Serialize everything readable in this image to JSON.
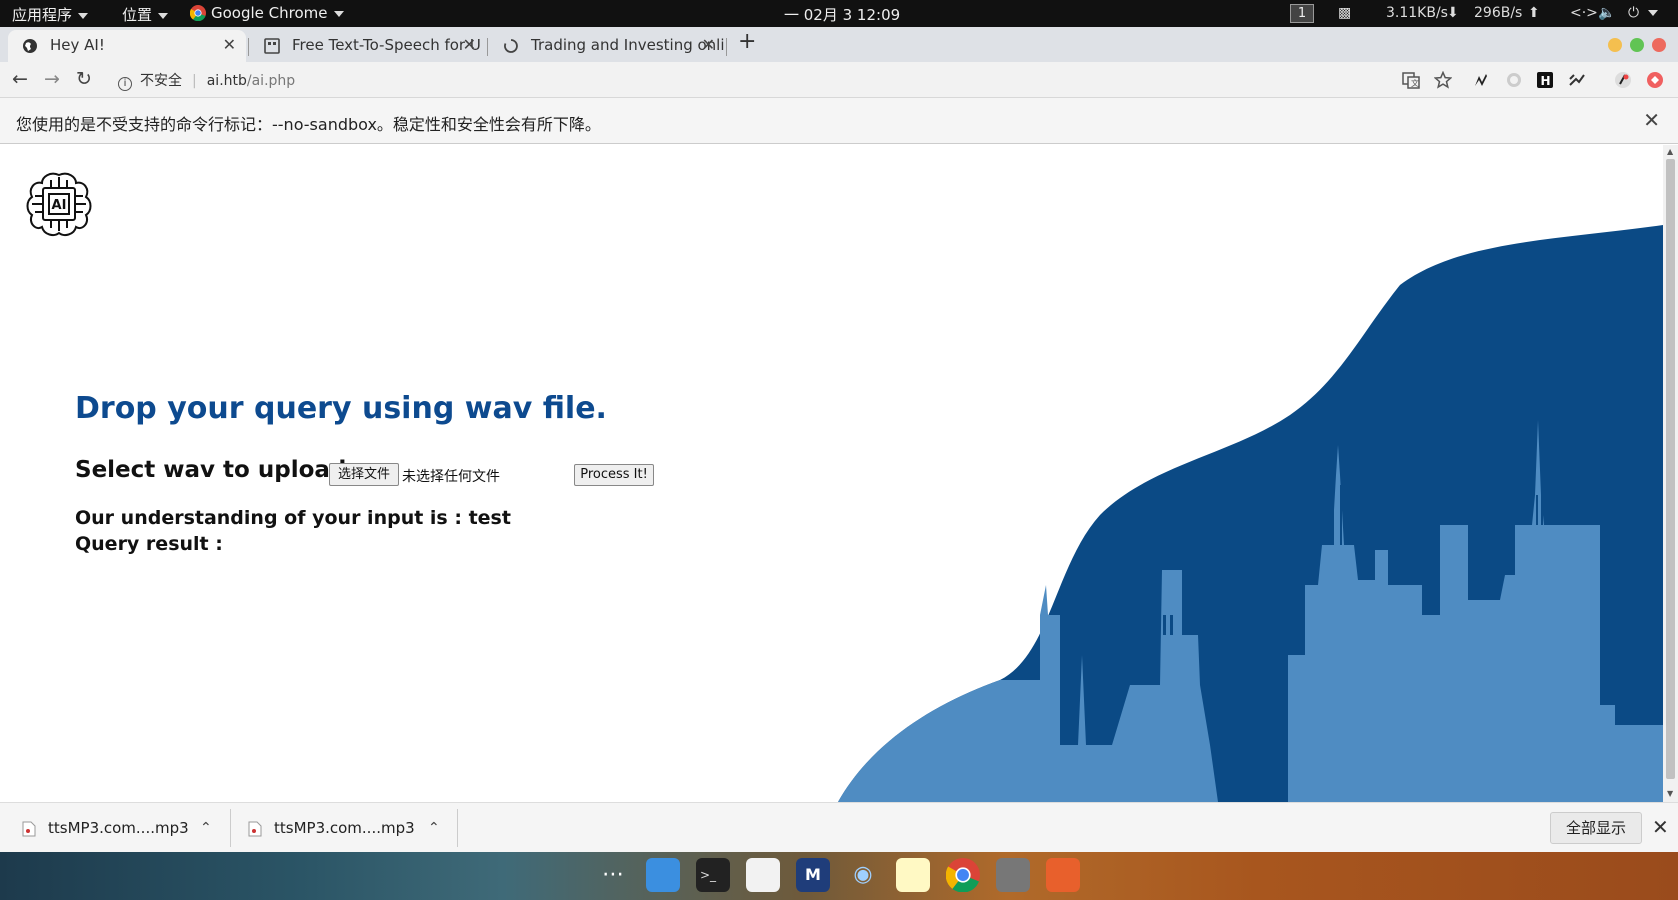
{
  "topbar": {
    "apps_menu": "应用程序",
    "places_menu": "位置",
    "active_app": "Google Chrome",
    "clock": "一 02月 3  12:09",
    "workspace": "1",
    "net_down": "3.11KB/s",
    "net_up": "296B/s"
  },
  "tabs": [
    {
      "title": "Hey AI!"
    },
    {
      "title": "Free Text-To-Speech for U"
    },
    {
      "title": "Trading and Investing onlin"
    }
  ],
  "omnibox": {
    "security": "不安全",
    "host": "ai.htb",
    "path": "/ai.php"
  },
  "infobar": {
    "message": "您使用的是不受支持的命令行标记：--no-sandbox。稳定性和安全性会有所下降。"
  },
  "page": {
    "logo_text": "AI",
    "headline": "Drop your query using wav file.",
    "upload_label": "Select wav to upload:",
    "choose_file_button": "选择文件",
    "no_file_text": "未选择任何文件",
    "process_button": "Process It!",
    "understanding_text": "Our understanding of your input is : test",
    "query_result_text": "Query result :"
  },
  "colors": {
    "heading_blue": "#0d4a8f",
    "wave_dark": "#0b4a85",
    "city_light": "#4f8cc2"
  },
  "downloads": {
    "items": [
      {
        "name": "ttsMP3.com....mp3"
      },
      {
        "name": "ttsMP3.com....mp3"
      }
    ],
    "show_all": "全部显示"
  }
}
